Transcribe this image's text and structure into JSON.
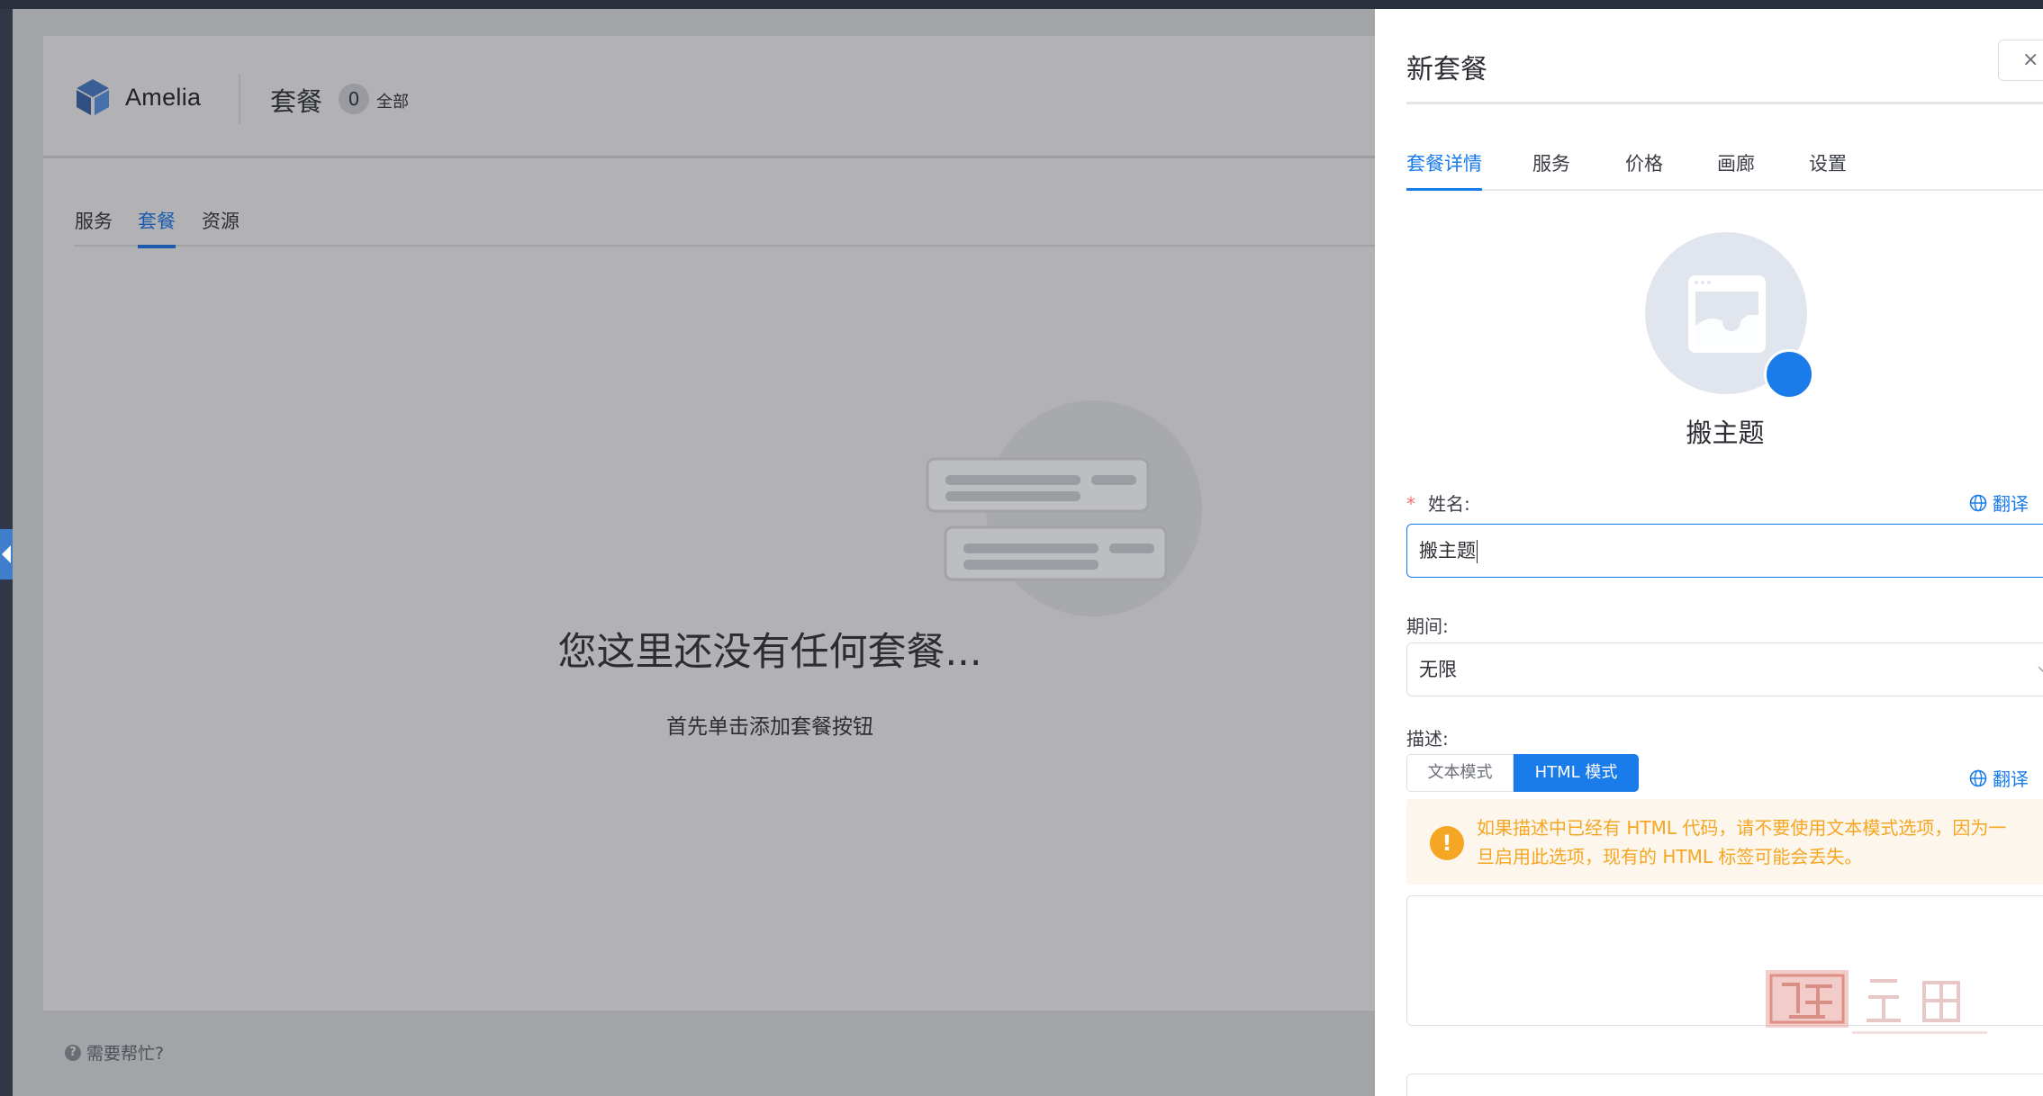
{
  "app": {
    "brand_name": "Amelia"
  },
  "header": {
    "title": "套餐",
    "count": "0",
    "count_label": "全部"
  },
  "subtabs": [
    {
      "label": "服务"
    },
    {
      "label": "套餐",
      "active": true
    },
    {
      "label": "资源"
    }
  ],
  "empty_state": {
    "title": "您这里还没有任何套餐...",
    "subtitle": "首先单击添加套餐按钮"
  },
  "help": {
    "label": "需要帮忙?"
  },
  "drawer": {
    "title": "新套餐",
    "close_icon": "close-icon",
    "tabs": [
      {
        "label": "套餐详情",
        "active": true
      },
      {
        "label": "服务"
      },
      {
        "label": "价格"
      },
      {
        "label": "画廊"
      },
      {
        "label": "设置"
      }
    ],
    "avatar_name": "搬主题",
    "name_field": {
      "required_mark": "*",
      "label": "姓名:",
      "value": "搬主题",
      "translate_label": "翻译"
    },
    "duration_field": {
      "label": "期间:",
      "value": "无限"
    },
    "description_field": {
      "label": "描述:",
      "modes": [
        {
          "label": "文本模式"
        },
        {
          "label": "HTML 模式",
          "active": true
        }
      ],
      "translate_label": "翻译",
      "alert_text": "如果描述中已经有 HTML 代码，请不要使用文本模式选项，因为一旦启用此选项，现有的 HTML 标签可能会丢失。"
    }
  },
  "colors": {
    "primary": "#1a7bea",
    "brand_blue": "#1c5caf",
    "warning": "#f5a623",
    "warning_bg": "#fdf6ec",
    "overlay": "#a3a4a8"
  }
}
